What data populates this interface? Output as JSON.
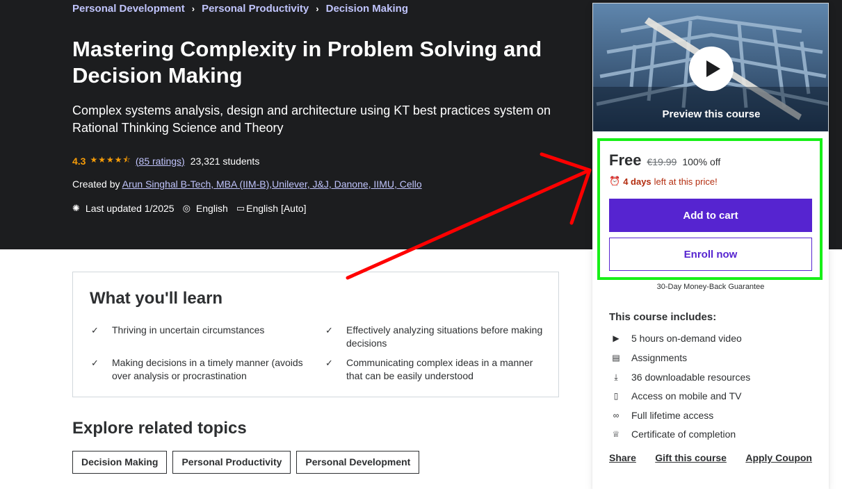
{
  "breadcrumbs": [
    "Personal Development",
    "Personal Productivity",
    "Decision Making"
  ],
  "course": {
    "title": "Mastering Complexity in Problem Solving and Decision Making",
    "subtitle": "Complex systems analysis, design and architecture using KT best practices system on Rational Thinking Science and Theory",
    "rating": "4.3",
    "rating_fraction": 0.86,
    "ratings_link": "(85 ratings)",
    "students": "23,321 students",
    "created_prefix": "Created by",
    "author": "Arun Singhal B-Tech, MBA (IIM-B),Unilever, J&J, Danone, IIMU, Cello",
    "last_updated": "Last updated 1/2025",
    "language": "English",
    "captions": "English [Auto]"
  },
  "learn": {
    "title": "What you'll learn",
    "items": [
      "Thriving in uncertain circumstances",
      "Effectively analyzing situations before making decisions",
      "Making decisions in a timely manner (avoids over analysis or procrastination",
      "Communicating complex ideas in a manner that can be easily understood"
    ]
  },
  "related": {
    "title": "Explore related topics",
    "chips": [
      "Decision Making",
      "Personal Productivity",
      "Personal Development"
    ]
  },
  "sidebar": {
    "preview_label": "Preview this course",
    "price": "Free",
    "old_price": "€19.99",
    "discount": "100% off",
    "timer_bold": "4 days",
    "timer_rest": "left at this price!",
    "add_to_cart": "Add to cart",
    "enroll_now": "Enroll now",
    "guarantee": "30-Day Money-Back Guarantee",
    "includes_title": "This course includes:",
    "includes": [
      {
        "icon": "video-icon",
        "text": "5 hours on-demand video"
      },
      {
        "icon": "assignment-icon",
        "text": "Assignments"
      },
      {
        "icon": "download-icon",
        "text": "36 downloadable resources"
      },
      {
        "icon": "mobile-icon",
        "text": "Access on mobile and TV"
      },
      {
        "icon": "infinity-icon",
        "text": "Full lifetime access"
      },
      {
        "icon": "trophy-icon",
        "text": "Certificate of completion"
      }
    ],
    "links": [
      "Share",
      "Gift this course",
      "Apply Coupon"
    ]
  },
  "colors": {
    "hero_bg": "#1c1d1f",
    "accent_purple": "#5624d0",
    "link_lavender": "#c0c4fc",
    "star_orange": "#f69c08",
    "timer_red": "#b32d0f",
    "highlight_green": "#18f018",
    "annotation_arrow": "#ff0000"
  }
}
